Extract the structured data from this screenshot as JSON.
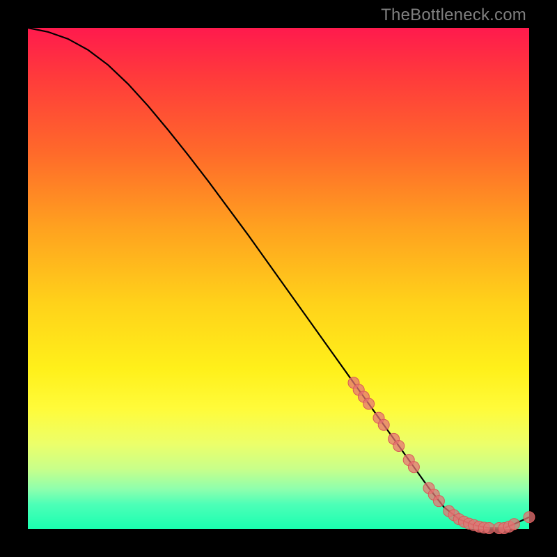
{
  "attribution": "TheBottleneck.com",
  "colors": {
    "background": "#000000",
    "gradient_top": "#ff1a4d",
    "gradient_bottom": "#1affb0",
    "curve": "#000000",
    "marker_stroke": "#d85959",
    "marker_fill": "#e57373"
  },
  "chart_data": {
    "type": "line",
    "title": "",
    "xlabel": "",
    "ylabel": "",
    "xlim": [
      0,
      100
    ],
    "ylim": [
      0,
      100
    ],
    "curve": {
      "x": [
        0,
        4,
        8,
        12,
        16,
        20,
        24,
        28,
        32,
        36,
        40,
        44,
        48,
        52,
        56,
        60,
        64,
        68,
        72,
        76,
        80,
        83,
        86,
        89,
        92,
        95,
        97,
        100
      ],
      "y": [
        100,
        99.2,
        97.8,
        95.6,
        92.6,
        88.8,
        84.4,
        79.6,
        74.6,
        69.4,
        64.0,
        58.6,
        53.0,
        47.4,
        41.8,
        36.2,
        30.6,
        25.0,
        19.4,
        13.8,
        8.2,
        4.4,
        2.0,
        0.8,
        0.2,
        0.2,
        1.0,
        2.4
      ]
    },
    "series": [
      {
        "name": "markers",
        "x": [
          65,
          66,
          67,
          68,
          70,
          71,
          73,
          74,
          76,
          77,
          80,
          81,
          82,
          84,
          85,
          86,
          87,
          88,
          89,
          90,
          91,
          92,
          94,
          95,
          96,
          97,
          100
        ],
        "y": [
          29.2,
          27.8,
          26.4,
          25.0,
          22.2,
          20.8,
          18.0,
          16.6,
          13.8,
          12.4,
          8.2,
          6.9,
          5.6,
          3.6,
          2.8,
          2.0,
          1.5,
          1.1,
          0.8,
          0.5,
          0.3,
          0.2,
          0.2,
          0.2,
          0.5,
          1.0,
          2.4
        ]
      }
    ]
  }
}
